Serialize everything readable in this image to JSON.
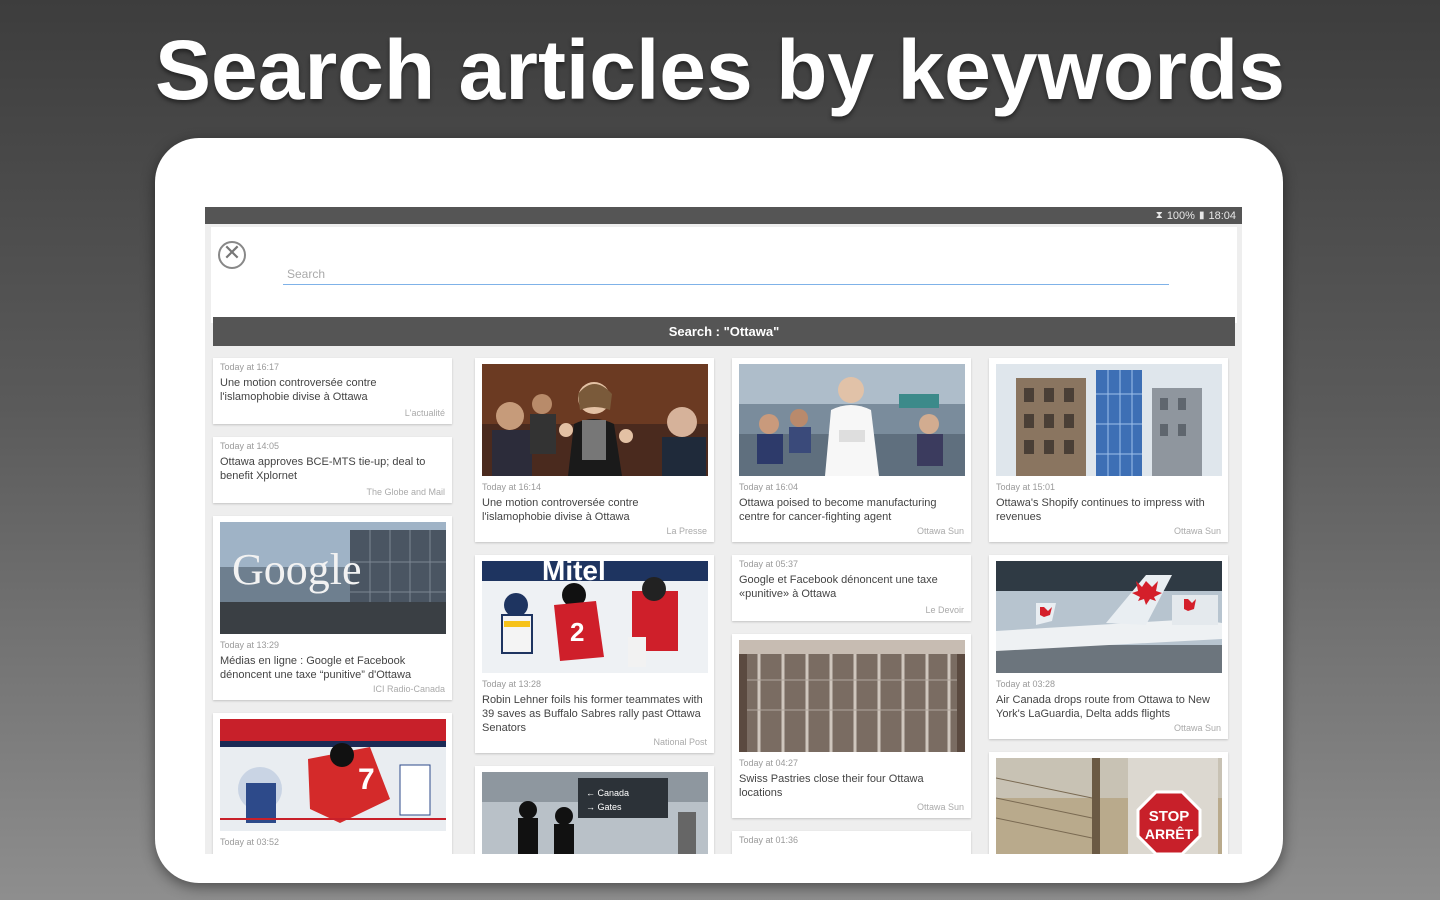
{
  "headline": "Search articles by keywords",
  "status_bar": {
    "battery": "100%",
    "time": "18:04"
  },
  "search": {
    "placeholder": "Search",
    "result_header": "Search : \"Ottawa\""
  },
  "columns": [
    [
      {
        "type": "text",
        "time": "Today at 16:17",
        "title": "Une motion controversée contre l'islamophobie divise à Ottawa",
        "source": "L'actualité"
      },
      {
        "type": "text",
        "time": "Today at 14:05",
        "title": "Ottawa approves BCE-MTS tie-up; deal to benefit Xplornet",
        "source": "The Globe and Mail"
      },
      {
        "type": "image",
        "image": "google-building-photo",
        "image_text": "Google",
        "time": "Today at 13:29",
        "title": "Médias en ligne : Google et Facebook dénoncent une taxe “punitive” d'Ottawa",
        "source": "ICI Radio-Canada"
      },
      {
        "type": "image",
        "image": "hockey-senators-photo",
        "time": "Today at 03:52",
        "title": "",
        "source": ""
      }
    ],
    [
      {
        "type": "image",
        "image": "politician-speaking-photo",
        "time": "Today at 16:14",
        "title": "Une motion controversée contre l'islamophobie divise à Ottawa",
        "source": "La Presse"
      },
      {
        "type": "image",
        "image": "hockey-sabres-photo",
        "image_text": "Mitel",
        "time": "Today at 13:28",
        "title": "Robin Lehner foils his former teammates with 39 saves as Buffalo Sabres rally past Ottawa Senators",
        "source": "National Post"
      },
      {
        "type": "image",
        "image": "airport-silhouettes-photo",
        "time": "",
        "title": "",
        "source": ""
      }
    ],
    [
      {
        "type": "image",
        "image": "lab-doctor-photo",
        "time": "Today at 16:04",
        "title": "Ottawa poised to become manufacturing centre for cancer-fighting agent",
        "source": "Ottawa Sun"
      },
      {
        "type": "text",
        "time": "Today at 05:37",
        "title": "Google et Facebook dénoncent une taxe «punitive» à Ottawa",
        "source": "Le Devoir"
      },
      {
        "type": "image",
        "image": "store-shutter-photo",
        "time": "Today at 04:27",
        "title": "Swiss Pastries close their four Ottawa locations",
        "source": "Ottawa Sun"
      },
      {
        "type": "text",
        "time": "Today at 01:36",
        "title": "",
        "source": ""
      }
    ],
    [
      {
        "type": "image",
        "image": "city-buildings-photo",
        "time": "Today at 15:01",
        "title": "Ottawa's Shopify continues to impress with revenues",
        "source": "Ottawa Sun"
      },
      {
        "type": "image",
        "image": "air-canada-planes-photo",
        "time": "Today at 03:28",
        "title": "Air Canada drops route from Ottawa to New York's LaGuardia, Delta adds flights",
        "source": "Ottawa Sun"
      },
      {
        "type": "image",
        "image": "stop-sign-photo",
        "stop_text_1": "STOP",
        "stop_text_2": "ARRÊT",
        "time": "",
        "title": "",
        "source": ""
      }
    ]
  ],
  "colors": {
    "status_bar": "#555555",
    "result_bar": "#555555",
    "search_underline": "#7fb2e8",
    "tablet": "#ffffff"
  }
}
